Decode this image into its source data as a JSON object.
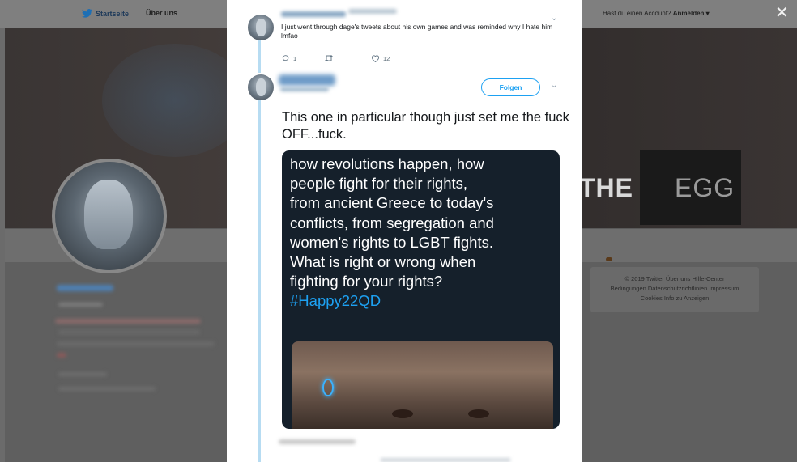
{
  "topbar": {
    "home_label": "Startseite",
    "about_label": "Über uns",
    "account_prompt": "Hast du einen Account?",
    "login_label": "Anmelden ▾",
    "close_glyph": "✕"
  },
  "banner": {
    "word_the": "THE",
    "word_egg": "EGG"
  },
  "footer": {
    "line1": "© 2019 Twitter   Über uns   Hilfe-Center",
    "line2": "Bedingungen   Datenschutzrichtlinien   Impressum",
    "line3": "Cookies   Info zu Anzeigen"
  },
  "tweet1": {
    "text": "I just went through dage's tweets about his own games and was reminded why I hate him lmfao",
    "replies": "1",
    "likes": "12",
    "reply_icon": "reply-icon",
    "retweet_icon": "retweet-icon",
    "like_icon": "heart-icon"
  },
  "tweet2": {
    "follow_label": "Folgen",
    "text": "This one in particular though just set me the fuck OFF...fuck.",
    "media_text": "how revolutions happen, how\npeople fight for their rights,\nfrom ancient Greece to today's\nconflicts, from segregation and\nwomen's rights to LGBT fights.\nWhat is right or wrong when\nfighting for your rights?",
    "media_hashtag": "#Happy22QD"
  },
  "colors": {
    "accent": "#1da1f2",
    "media_bg": "#15202b",
    "thread_line": "#b7dcf2"
  }
}
